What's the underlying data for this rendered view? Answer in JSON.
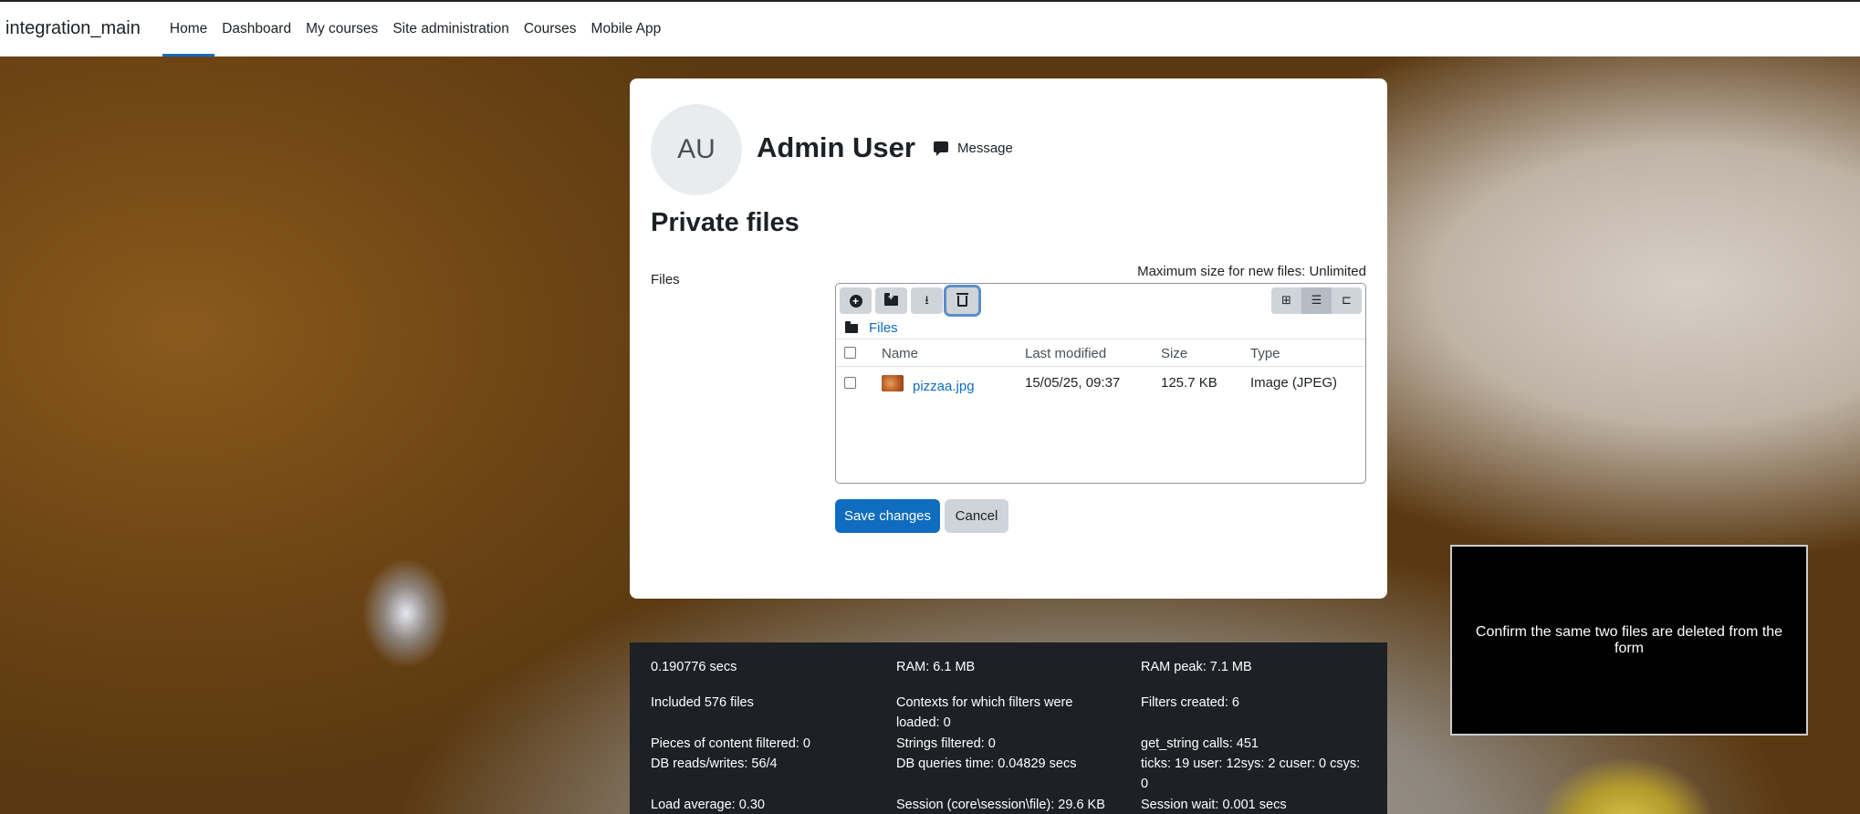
{
  "navbar": {
    "brand": "integration_main",
    "items": [
      {
        "label": "Home",
        "active": true
      },
      {
        "label": "Dashboard"
      },
      {
        "label": "My courses"
      },
      {
        "label": "Site administration"
      },
      {
        "label": "Courses"
      },
      {
        "label": "Mobile App"
      }
    ]
  },
  "profile": {
    "initials": "AU",
    "name": "Admin User",
    "message_label": "Message"
  },
  "page": {
    "title": "Private files",
    "files_label": "Files",
    "max_size": "Maximum size for new files: Unlimited"
  },
  "filemanager": {
    "path_label": "Files",
    "columns": {
      "name": "Name",
      "modified": "Last modified",
      "size": "Size",
      "type": "Type"
    },
    "files": [
      {
        "name": "pizzaa.jpg",
        "modified": "15/05/25, 09:37",
        "size": "125.7 KB",
        "type": "Image (JPEG)"
      }
    ]
  },
  "buttons": {
    "save": "Save changes",
    "cancel": "Cancel"
  },
  "perf": {
    "c1": "0.190776 secs",
    "c2": "RAM: 6.1 MB",
    "c3": "RAM peak: 7.1 MB",
    "c4": "Included 576 files",
    "c5a": "Contexts for which filters were",
    "c5b": "loaded: 0",
    "c6": "Filters created: 6",
    "c7": "Pieces of content filtered: 0",
    "c8": "Strings filtered: 0",
    "c9": "get_string calls: 451",
    "c10": "DB reads/writes: 56/4",
    "c11": "DB queries time: 0.04829 secs",
    "c12a": "ticks: 19 user: 12sys: 2 cuser: 0 csys:",
    "c12b": "0",
    "c13": "Load average: 0.30",
    "c14": "Session (core\\session\\file): 29.6 KB",
    "c15": "Session wait: 0.001 secs"
  },
  "overlay": {
    "text": "Confirm the same two files are deleted from the form"
  },
  "colors": {
    "primary": "#0f6cbf",
    "navbar_bg": "#ffffff",
    "footer_bg": "#1d2125"
  }
}
